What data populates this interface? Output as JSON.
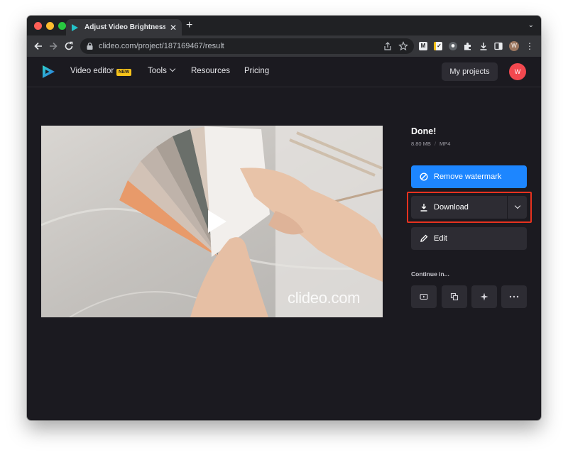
{
  "browser": {
    "tab_title": "Adjust Video Brightness, Contrast",
    "url": "clideo.com/project/187169467/result",
    "profile_initial": "W"
  },
  "site": {
    "nav": {
      "video_editor": "Video editor",
      "new_badge": "NEW",
      "tools": "Tools",
      "resources": "Resources",
      "pricing": "Pricing"
    },
    "my_projects": "My projects",
    "avatar_initial": "W"
  },
  "video": {
    "watermark": "clideo.com"
  },
  "result": {
    "status": "Done!",
    "size": "8.80 MB",
    "separator": "/",
    "format": "MP4",
    "remove_watermark": "Remove watermark",
    "download": "Download",
    "edit": "Edit",
    "continue_label": "Continue in..."
  },
  "colors": {
    "accent_blue": "#1d86ff",
    "highlight_red": "#e8321f",
    "avatar_red": "#f2484f",
    "background": "#1b1a20"
  },
  "icons": [
    "play-icon",
    "download-icon",
    "pencil-icon",
    "no-watermark-icon",
    "youtube-icon",
    "layers-icon",
    "sparkle-icon",
    "more-icon"
  ]
}
